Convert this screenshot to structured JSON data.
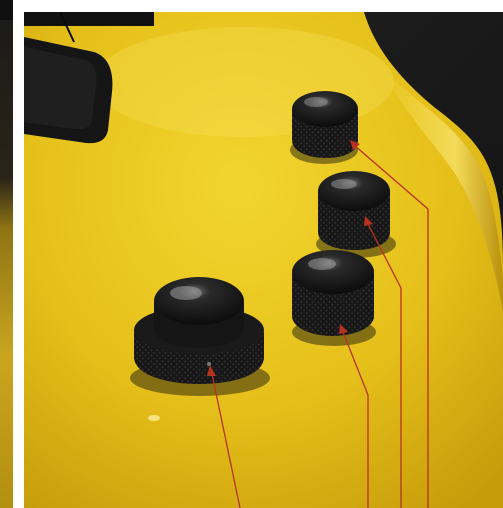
{
  "image": {
    "subject": "yellow-bass-guitar-control-knobs",
    "colors": {
      "body_yellow": "#e6c21c",
      "body_highlight": "#f4dc4a",
      "body_shadow": "#b58c08",
      "background_dark": "#1b1a1a",
      "knob_black": "#141414",
      "leader_line": "#b7331f",
      "left_strip": "#c8a520",
      "margin_white": "#ffffff"
    },
    "knobs": [
      {
        "name": "master-volume-knob",
        "kind": "stacked-concentric"
      },
      {
        "name": "knob-2",
        "kind": "knurled-dome"
      },
      {
        "name": "knob-3",
        "kind": "knurled-dome"
      },
      {
        "name": "knob-4",
        "kind": "knurled-dome"
      }
    ]
  }
}
